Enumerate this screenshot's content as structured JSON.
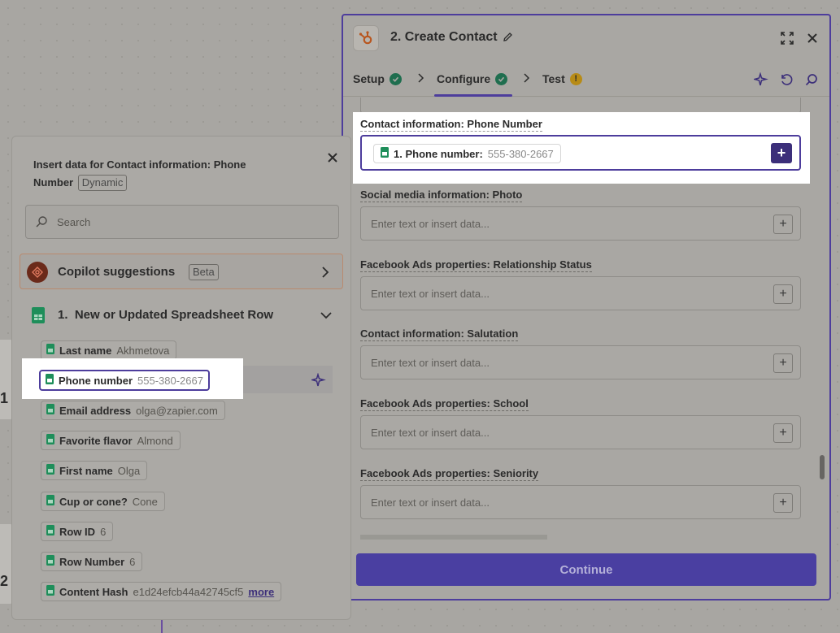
{
  "editor": {
    "title": "2. Create Contact",
    "tabs": [
      {
        "label": "Setup",
        "status": "complete"
      },
      {
        "label": "Configure",
        "status": "complete"
      },
      {
        "label": "Test",
        "status": "warning"
      }
    ],
    "warning_glyph": "!",
    "active_field": {
      "label": "Contact information: Phone Number",
      "pill_key": "1. Phone number:",
      "pill_value": "555-380-2667"
    },
    "fields": [
      {
        "label": "Social media information: Photo",
        "placeholder": "Enter text or insert data..."
      },
      {
        "label": "Facebook Ads properties: Relationship Status",
        "placeholder": "Enter text or insert data..."
      },
      {
        "label": "Contact information: Salutation",
        "placeholder": "Enter text or insert data..."
      },
      {
        "label": "Facebook Ads properties: School",
        "placeholder": "Enter text or insert data..."
      },
      {
        "label": "Facebook Ads properties: Seniority",
        "placeholder": "Enter text or insert data..."
      }
    ],
    "continue_label": "Continue",
    "plus_glyph": "+"
  },
  "insert_panel": {
    "title": "Insert data for Contact information: Phone Number",
    "title_badge": "Dynamic",
    "search_placeholder": "Search",
    "copilot_label": "Copilot suggestions",
    "copilot_badge": "Beta",
    "step_label": "1.  New or Updated Spreadsheet Row",
    "items": [
      {
        "key": "Last name",
        "value": "Akhmetova"
      },
      {
        "key": "Phone number",
        "value": "555-380-2667"
      },
      {
        "key": "Email address",
        "value": "olga@zapier.com"
      },
      {
        "key": "Favorite flavor",
        "value": "Almond"
      },
      {
        "key": "First name",
        "value": "Olga"
      },
      {
        "key": "Cup or cone?",
        "value": "Cone"
      },
      {
        "key": "Row ID",
        "value": "6"
      },
      {
        "key": "Row Number",
        "value": "6"
      },
      {
        "key": "Content Hash",
        "value": "e1d24efcb44a42745cf5",
        "more": "more"
      }
    ]
  },
  "canvas": {
    "node_label_1": "1",
    "node_label_2": "2"
  },
  "colors": {
    "accent": "#4d3d9c",
    "sheets_green": "#1e8e5a",
    "check_green": "#1f6e4f",
    "warning": "#b78b16"
  },
  "icons": [
    "hubspot-icon",
    "pencil-icon",
    "expand-icon",
    "close-icon",
    "sparkle-icon",
    "undo-icon",
    "search-icon",
    "sheets-icon",
    "copilot-logo-icon",
    "chevron-right-icon",
    "chevron-down-icon"
  ]
}
